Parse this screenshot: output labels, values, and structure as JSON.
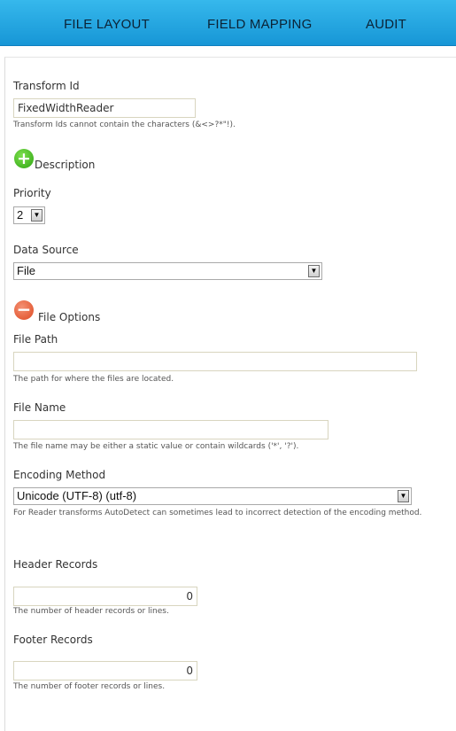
{
  "tabs": {
    "file_layout": "FILE LAYOUT",
    "field_mapping": "FIELD MAPPING",
    "audit": "AUDIT"
  },
  "transform": {
    "label": "Transform Id",
    "value": "FixedWidthReader",
    "hint": "Transform Ids cannot contain the characters (&<>?*\"!)."
  },
  "description": {
    "label": "Description",
    "icon": "add-circle-icon"
  },
  "priority": {
    "label": "Priority",
    "value": "2"
  },
  "data_source": {
    "label": "Data Source",
    "value": "File"
  },
  "file_options": {
    "label": "File Options",
    "icon": "remove-circle-icon"
  },
  "file_path": {
    "label": "File Path",
    "value": "",
    "hint": "The path for where the files are located."
  },
  "file_name": {
    "label": "File Name",
    "value": "",
    "hint": "The file name may be either a static value or contain wildcards ('*', '?')."
  },
  "encoding": {
    "label": "Encoding Method",
    "value": "Unicode (UTF-8) (utf-8)",
    "hint": "For Reader transforms AutoDetect can sometimes lead to incorrect detection of the encoding method."
  },
  "header_records": {
    "label": "Header Records",
    "value": "0",
    "hint": "The number of header records or lines."
  },
  "footer_records": {
    "label": "Footer Records",
    "value": "0",
    "hint": "The number of footer records or lines."
  },
  "colors": {
    "topbar": "#1da2df",
    "tab_text": "#0b2336",
    "add_icon": "#3cb01a",
    "remove_icon": "#e55a2f"
  }
}
